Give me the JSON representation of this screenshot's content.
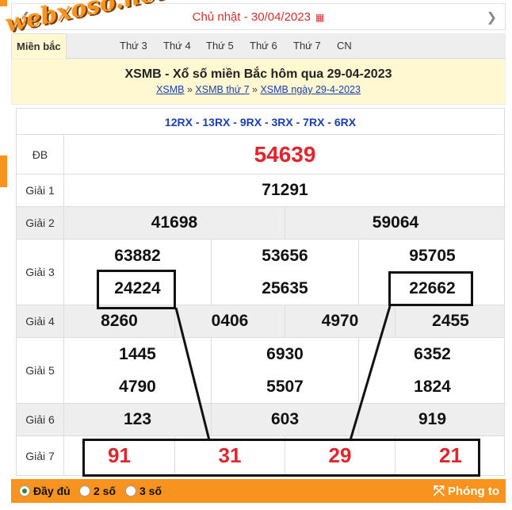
{
  "date_bar": {
    "prev_arrow": "❮",
    "next_arrow": "❯",
    "date_text": "Chủ nhật - 30/04/2023",
    "calendar_icon": "▦"
  },
  "tabs": [
    "Miền bắc",
    "Thứ 3",
    "Thứ 4",
    "Thứ 5",
    "Thứ 6",
    "Thứ 7",
    "CN"
  ],
  "active_tab": "Miền bắc",
  "watermark": "webxoso.net",
  "header": {
    "title": "XSMB - Xổ số miền Bắc hôm qua 29-04-2023",
    "crumbs": [
      "XSMB",
      "XSMB thứ 7",
      "XSMB ngày 29-4-2023"
    ],
    "separator": "»"
  },
  "codes": "12RX - 13RX - 9RX - 3RX - 7RX - 6RX",
  "prizes": {
    "db": {
      "label": "ĐB",
      "numbers": [
        "54639"
      ]
    },
    "g1": {
      "label": "Giải 1",
      "numbers": [
        "71291"
      ]
    },
    "g2": {
      "label": "Giải 2",
      "numbers": [
        "41698",
        "59064"
      ]
    },
    "g3": {
      "label": "Giải 3",
      "numbers": [
        "63882",
        "53656",
        "95705",
        "24224",
        "25635",
        "22662"
      ]
    },
    "g4": {
      "label": "Giải 4",
      "numbers": [
        "8260",
        "0406",
        "4970",
        "2455"
      ]
    },
    "g5": {
      "label": "Giải 5",
      "numbers": [
        "1445",
        "6930",
        "6352",
        "4790",
        "5507",
        "1824"
      ]
    },
    "g6": {
      "label": "Giải 6",
      "numbers": [
        "123",
        "603",
        "919"
      ]
    },
    "g7": {
      "label": "Giải 7",
      "numbers": [
        "91",
        "31",
        "29",
        "21"
      ]
    }
  },
  "bottom_bar": {
    "options": [
      "Đầy đủ",
      "2 số",
      "3 số"
    ],
    "selected": "Đầy đủ",
    "zoom_label": "Phóng to",
    "zoom_icon": "⤧"
  },
  "colors": {
    "accent": "#f7931e",
    "prize_red": "#e0262c",
    "link_blue": "#1a3fb3",
    "header_bg": "#fff8d0"
  }
}
